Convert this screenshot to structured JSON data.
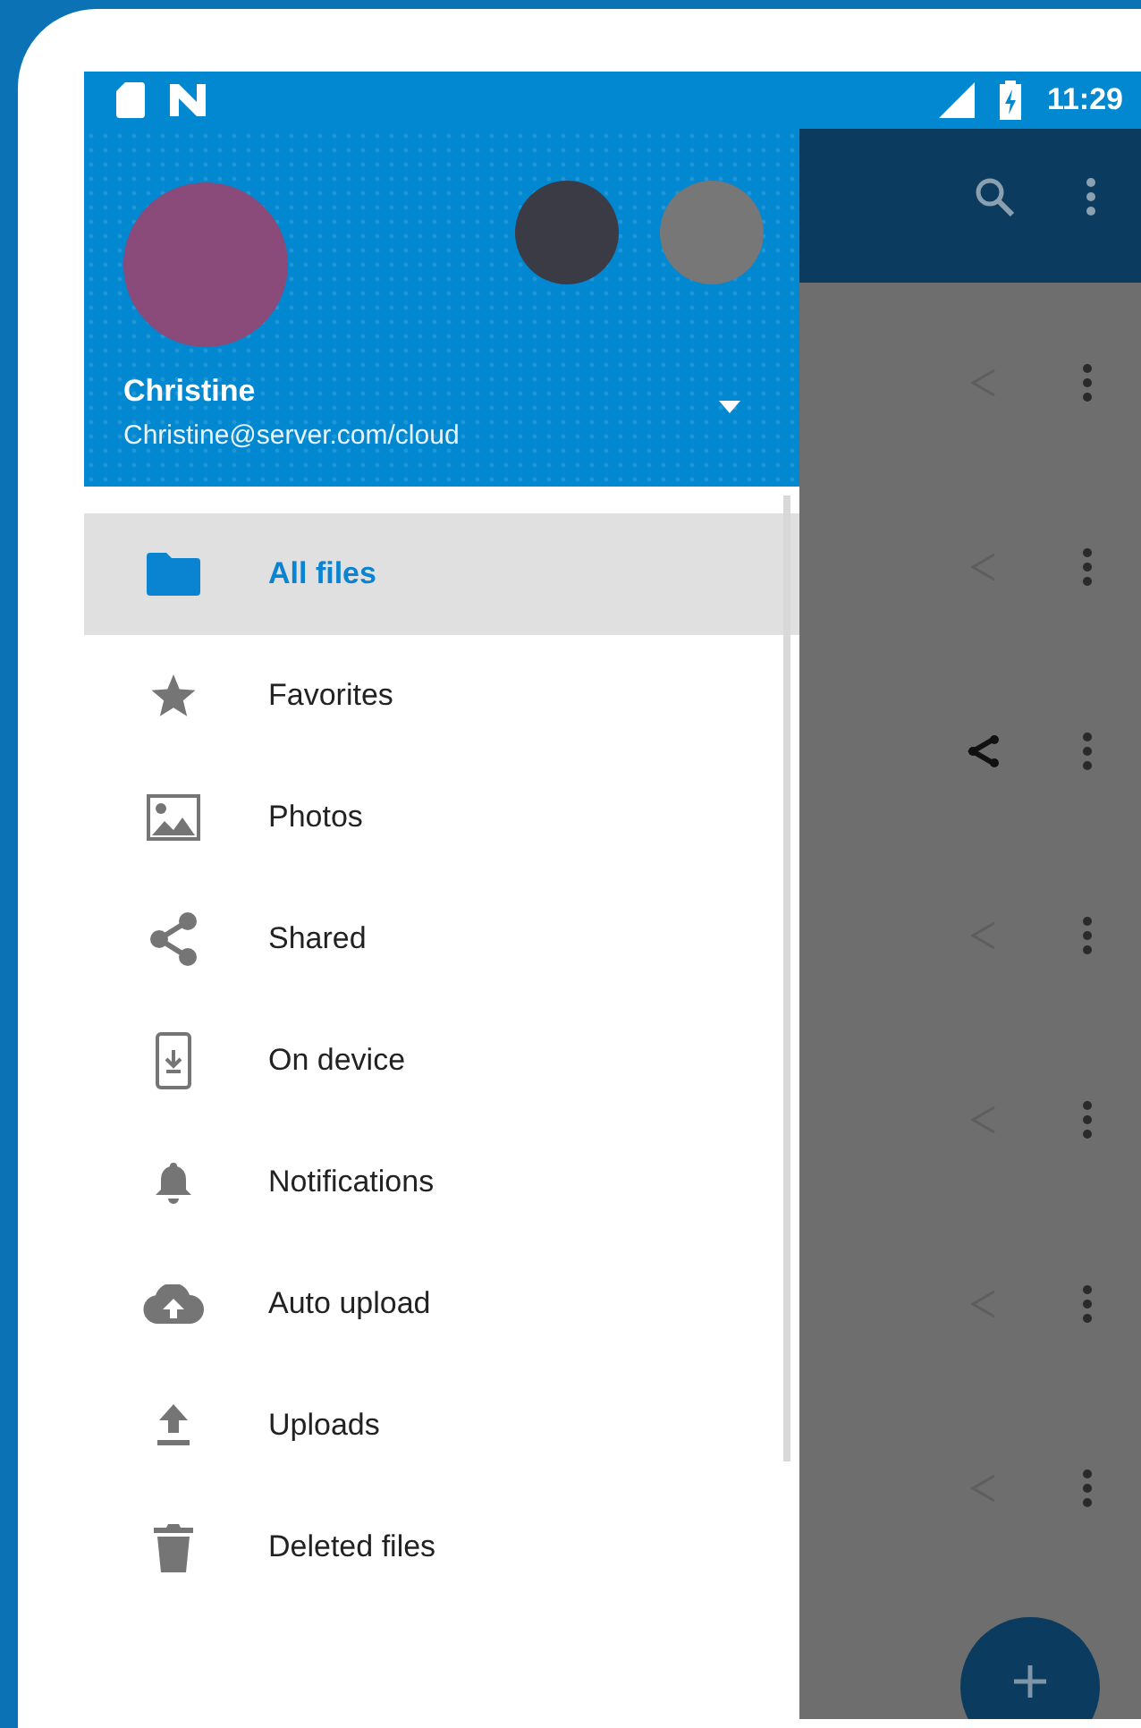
{
  "status_bar": {
    "time": "11:29"
  },
  "account": {
    "name": "Christine",
    "address": "Christine@server.com/cloud"
  },
  "menu": [
    {
      "label": "All files",
      "selected": true
    },
    {
      "label": "Favorites",
      "selected": false
    },
    {
      "label": "Photos",
      "selected": false
    },
    {
      "label": "Shared",
      "selected": false
    },
    {
      "label": "On device",
      "selected": false
    },
    {
      "label": "Notifications",
      "selected": false
    },
    {
      "label": "Auto upload",
      "selected": false
    },
    {
      "label": "Uploads",
      "selected": false
    },
    {
      "label": "Deleted files",
      "selected": false
    }
  ],
  "files": [
    {
      "shared": false
    },
    {
      "shared": false
    },
    {
      "shared": true
    },
    {
      "shared": false
    },
    {
      "shared": false
    },
    {
      "shared": false
    },
    {
      "shared": false
    }
  ]
}
